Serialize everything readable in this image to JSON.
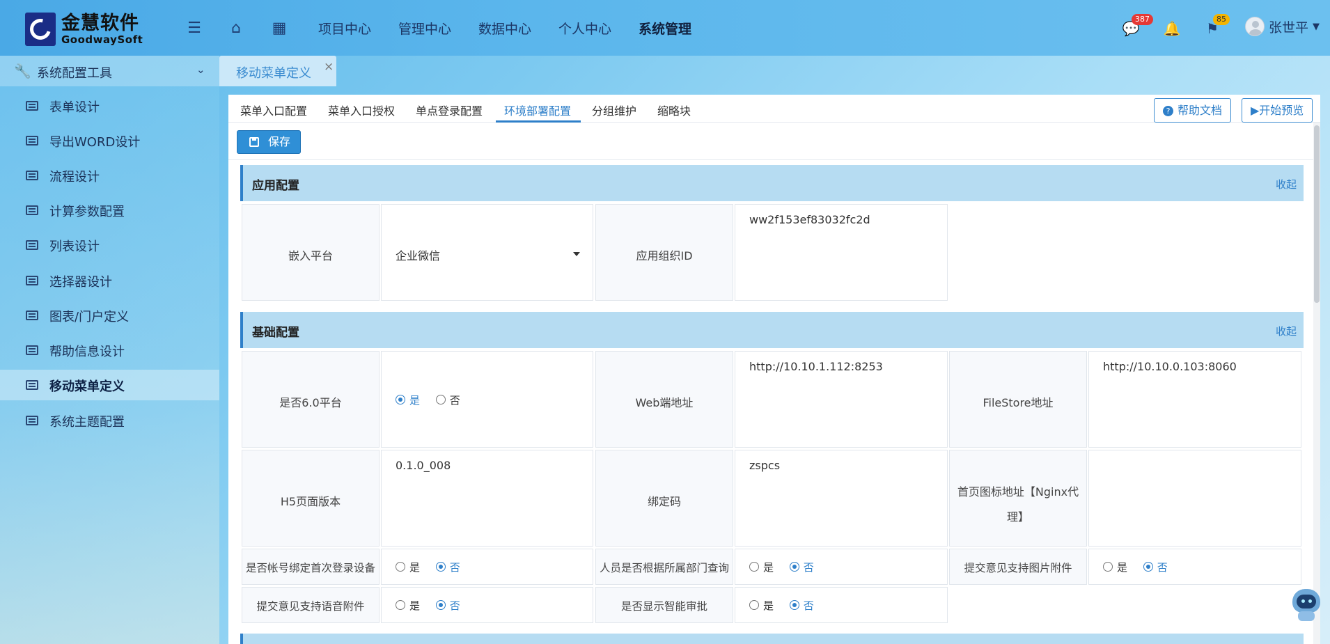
{
  "brand": {
    "name_cn": "金慧软件",
    "name_en": "GoodwaySoft"
  },
  "nav": {
    "items": [
      "项目中心",
      "管理中心",
      "数据中心",
      "个人中心",
      "系统管理"
    ],
    "active": "系统管理"
  },
  "header": {
    "messages_badge": "387",
    "flags_badge": "85",
    "user_name": "张世平"
  },
  "sidebar": {
    "group_title": "系统配置工具",
    "items": [
      "表单设计",
      "导出WORD设计",
      "流程设计",
      "计算参数配置",
      "列表设计",
      "选择器设计",
      "图表/门户定义",
      "帮助信息设计",
      "移动菜单定义",
      "系统主题配置"
    ],
    "active_index": 8
  },
  "page_tab": {
    "label": "移动菜单定义",
    "close": "×"
  },
  "subtabs": {
    "items": [
      "菜单入口配置",
      "菜单入口授权",
      "单点登录配置",
      "环境部署配置",
      "分组维护",
      "缩略块"
    ],
    "active_index": 3
  },
  "actions": {
    "help": "帮助文档",
    "preview": "▶开始预览",
    "save": "保存"
  },
  "sections": {
    "app": {
      "title": "应用配置",
      "fold": "收起"
    },
    "basic": {
      "title": "基础配置",
      "fold": "收起"
    }
  },
  "app_config": {
    "platform_label": "嵌入平台",
    "platform_value": "企业微信",
    "org_id_label": "应用组织ID",
    "org_id_value": "ww2f153ef83032fc2d"
  },
  "basic_config": {
    "is60_label": "是否6.0平台",
    "is60_value": "是",
    "web_label": "Web端地址",
    "web_value": "http://10.10.1.112:8253",
    "filestore_label": "FileStore地址",
    "filestore_value": "http://10.10.0.103:8060",
    "h5_label": "H5页面版本",
    "h5_value": "0.1.0_008",
    "bind_label": "绑定码",
    "bind_value": "zspcs",
    "icon_label": "首页图标地址【Nginx代理】",
    "icon_label_line1": "首页图标地址【Nginx代",
    "icon_label_line2": "理】",
    "icon_value": "",
    "device_label": "是否帐号绑定首次登录设备",
    "device_value": "否",
    "dept_label": "人员是否根据所属部门查询",
    "dept_value": "否",
    "img_label": "提交意见支持图片附件",
    "img_value": "否",
    "voice_label": "提交意见支持语音附件",
    "voice_value": "否",
    "smart_label": "是否显示智能审批",
    "smart_value": "否"
  },
  "radio_options": {
    "yes": "是",
    "no": "否"
  },
  "colors": {
    "accent": "#2e7fc9",
    "section_bg": "#b6dcf2",
    "topbar": "#5bb6ec"
  }
}
